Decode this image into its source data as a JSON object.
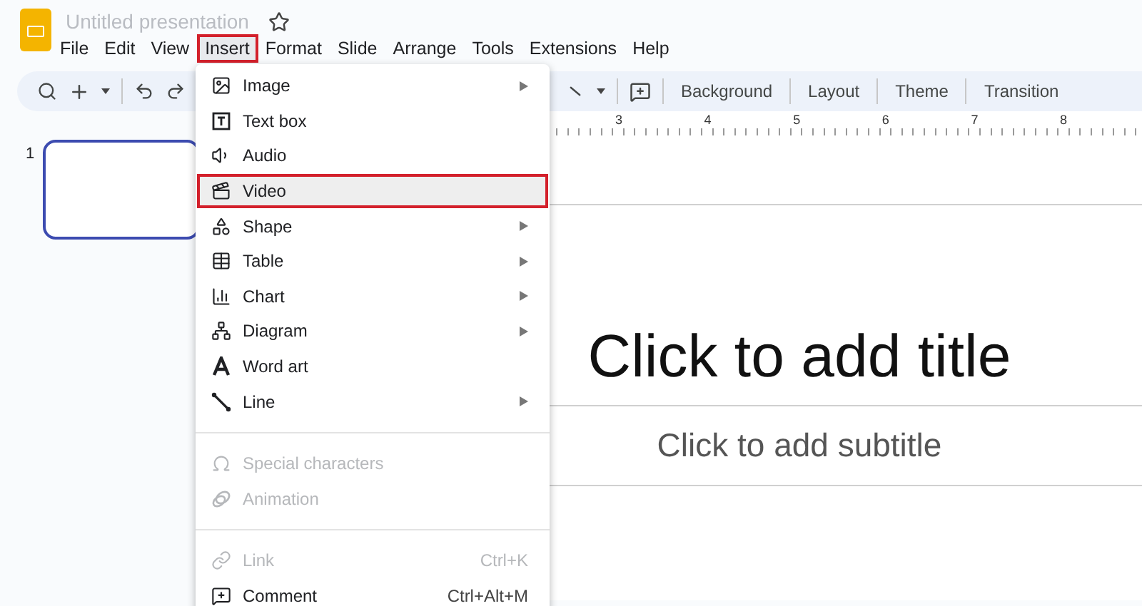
{
  "document": {
    "title": "Untitled presentation",
    "starred": false
  },
  "menubar": [
    {
      "label": "File",
      "selected": false
    },
    {
      "label": "Edit",
      "selected": false
    },
    {
      "label": "View",
      "selected": false
    },
    {
      "label": "Insert",
      "selected": true
    },
    {
      "label": "Format",
      "selected": false
    },
    {
      "label": "Slide",
      "selected": false
    },
    {
      "label": "Arrange",
      "selected": false
    },
    {
      "label": "Tools",
      "selected": false
    },
    {
      "label": "Extensions",
      "selected": false
    },
    {
      "label": "Help",
      "selected": false
    }
  ],
  "toolbar": {
    "buttons": [
      "Background",
      "Layout",
      "Theme",
      "Transition"
    ]
  },
  "ruler": [
    "3",
    "4",
    "5",
    "6",
    "7",
    "8"
  ],
  "filmstrip": [
    {
      "number": "1",
      "selected": true
    }
  ],
  "insert_menu": [
    {
      "kind": "item",
      "label": "Image",
      "submenu": true,
      "disabled": false,
      "selected": false
    },
    {
      "kind": "item",
      "label": "Text box",
      "submenu": false,
      "disabled": false,
      "selected": false
    },
    {
      "kind": "item",
      "label": "Audio",
      "submenu": false,
      "disabled": false,
      "selected": false
    },
    {
      "kind": "item",
      "label": "Video",
      "submenu": false,
      "disabled": false,
      "selected": true
    },
    {
      "kind": "item",
      "label": "Shape",
      "submenu": true,
      "disabled": false,
      "selected": false
    },
    {
      "kind": "item",
      "label": "Table",
      "submenu": true,
      "disabled": false,
      "selected": false
    },
    {
      "kind": "item",
      "label": "Chart",
      "submenu": true,
      "disabled": false,
      "selected": false
    },
    {
      "kind": "item",
      "label": "Diagram",
      "submenu": true,
      "disabled": false,
      "selected": false
    },
    {
      "kind": "item",
      "label": "Word art",
      "submenu": false,
      "disabled": false,
      "selected": false
    },
    {
      "kind": "item",
      "label": "Line",
      "submenu": true,
      "disabled": false,
      "selected": false
    },
    {
      "kind": "divider"
    },
    {
      "kind": "item",
      "label": "Special characters",
      "submenu": false,
      "disabled": true,
      "selected": false
    },
    {
      "kind": "item",
      "label": "Animation",
      "submenu": false,
      "disabled": true,
      "selected": false
    },
    {
      "kind": "divider"
    },
    {
      "kind": "item",
      "label": "Link",
      "shortcut": "Ctrl+K",
      "submenu": false,
      "disabled": true,
      "selected": false
    },
    {
      "kind": "item",
      "label": "Comment",
      "shortcut": "Ctrl+Alt+M",
      "submenu": false,
      "disabled": false,
      "selected": false
    }
  ],
  "slide": {
    "title_placeholder": "Click to add title",
    "subtitle_placeholder": "Click to add subtitle"
  }
}
